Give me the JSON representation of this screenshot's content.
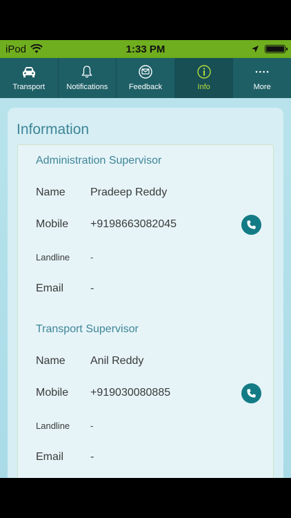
{
  "status_bar": {
    "carrier": "iPod",
    "time": "1:33 PM",
    "battery_level": 1.0
  },
  "tabs": [
    {
      "label": "Transport",
      "icon": "car-icon"
    },
    {
      "label": "Notifications",
      "icon": "bell-icon"
    },
    {
      "label": "Feedback",
      "icon": "feedback-icon"
    },
    {
      "label": "Info",
      "icon": "info-icon",
      "active": true
    },
    {
      "label": "More",
      "icon": "more-dots-icon"
    }
  ],
  "colors": {
    "status_bar": "#6fae1e",
    "tab_bar": "#1e5f66",
    "active_tab_text": "#b7dc3a",
    "accent": "#3e8597",
    "call_button": "#137b85"
  },
  "page": {
    "title": "Information"
  },
  "labels": {
    "name": "Name",
    "mobile": "Mobile",
    "landline": "Landline",
    "email": "Email"
  },
  "sections": [
    {
      "title": "Administration Supervisor",
      "name": "Pradeep Reddy",
      "mobile": "+919866308204​5",
      "landline": "-",
      "email": "-"
    },
    {
      "title": "Transport Supervisor",
      "name": "Anil Reddy",
      "mobile": "+919030080885",
      "landline": "-",
      "email": "-"
    }
  ]
}
